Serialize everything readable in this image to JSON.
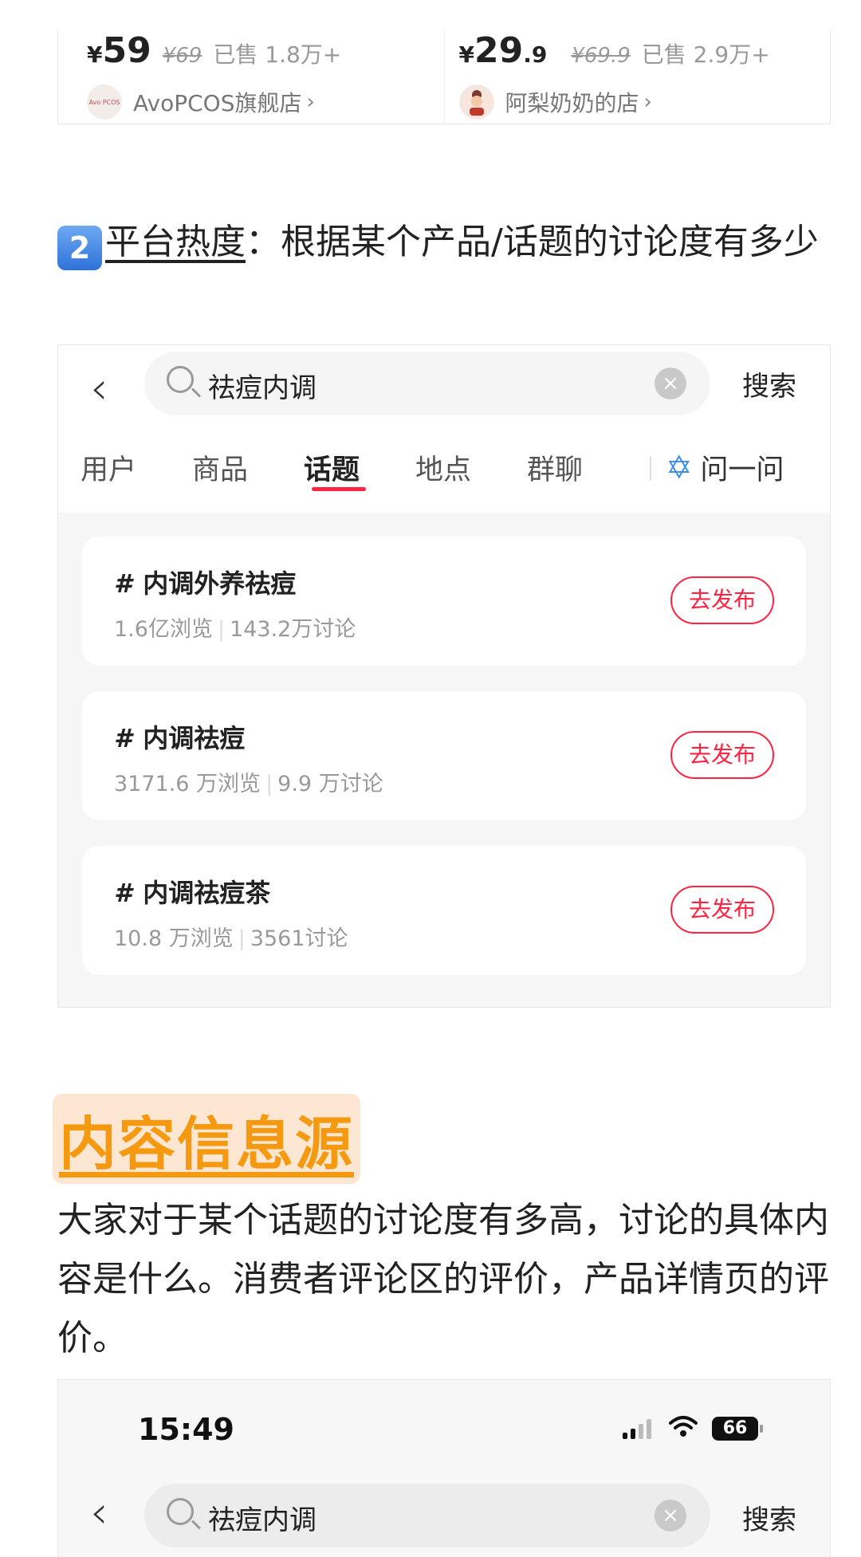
{
  "products": [
    {
      "yen": "¥",
      "price_int": "59",
      "price_dec": "",
      "price_old": "¥69",
      "sold": "已售 1.8万+",
      "shop": "AvoPCOS旗舰店",
      "avatar_text": "Avo PCOS"
    },
    {
      "yen": "¥",
      "price_int": "29",
      "price_dec": ".9",
      "price_old": "¥69.9",
      "sold": "已售 2.9万+",
      "shop": "阿梨奶奶的店",
      "avatar_text": ""
    }
  ],
  "section2": {
    "badge": "2",
    "title_underlined": "平台热度",
    "title_rest": "：根据某个产品/话题的讨论度有多少"
  },
  "search1": {
    "query": "祛痘内调",
    "search_label": "搜索",
    "tabs": [
      "用户",
      "商品",
      "话题",
      "地点",
      "群聊"
    ],
    "active_tab": "话题",
    "ask_label": "问一问",
    "topics": [
      {
        "title": "内调外养祛痘",
        "views": "1.6亿浏览",
        "discussions": "143.2万讨论",
        "action": "去发布"
      },
      {
        "title": "内调祛痘",
        "views": "3171.6 万浏览",
        "discussions": "9.9 万讨论",
        "action": "去发布"
      },
      {
        "title": "内调祛痘茶",
        "views": "10.8 万浏览",
        "discussions": "3561讨论",
        "action": "去发布"
      }
    ]
  },
  "section3": {
    "title": "内容信息源",
    "paragraph": "大家对于某个话题的讨论度有多高，讨论的具体内容是什么。消费者评论区的评价，产品详情页的评价。"
  },
  "search2": {
    "time": "15:49",
    "battery": "66",
    "query": "祛痘内调",
    "search_label": "搜索"
  },
  "colors": {
    "accent_red": "#ff2442",
    "heading_orange": "#f59a10",
    "ask_blue": "#3a8ee6"
  },
  "icons": [
    "back-chevron-icon",
    "search-icon",
    "clear-icon",
    "sparkle-star-icon",
    "wifi-icon",
    "signal-icon",
    "battery-icon"
  ]
}
